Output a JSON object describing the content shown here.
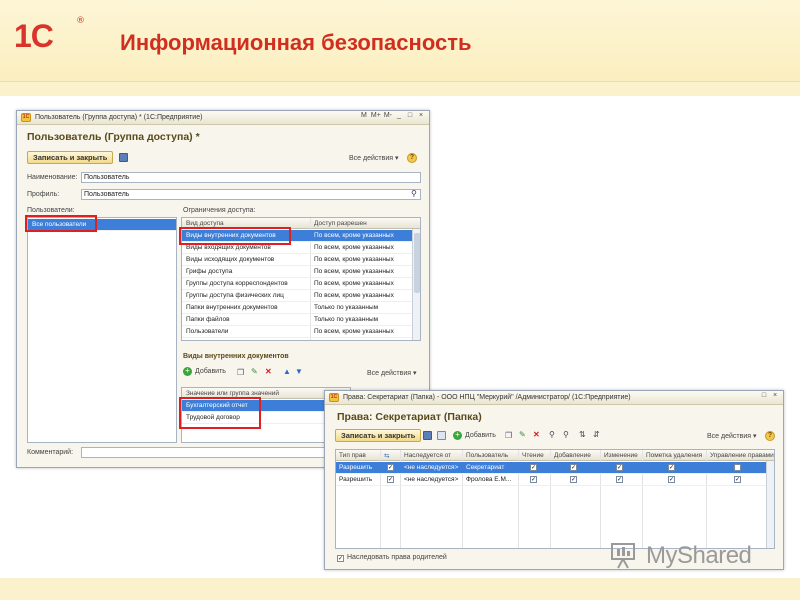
{
  "slide": {
    "logo_text": "1С",
    "logo_reg": "®",
    "title": "Информационная безопасность",
    "watermark": "MyShared"
  },
  "win1": {
    "title": "Пользователь (Группа доступа) * (1С:Предприятие)",
    "titlebar_buttons": [
      "M",
      "M+",
      "M-",
      "_",
      "□",
      "×"
    ],
    "form_title": "Пользователь (Группа доступа) *",
    "save_close_label": "Записать и закрыть",
    "all_actions_label": "Все действия ▾",
    "help_label": "?",
    "name_label": "Наименование:",
    "name_value": "Пользователь",
    "profile_label": "Профиль:",
    "profile_value": "Пользователь",
    "users_label": "Пользователи:",
    "users_items": [
      "Все пользователи"
    ],
    "restrictions_label": "Ограничения доступа:",
    "restrictions_columns": [
      "Вид доступа",
      "Доступ разрешен"
    ],
    "restrictions_rows": [
      [
        "Виды внутренних документов",
        "По всем, кроме указанных"
      ],
      [
        "Виды входящих документов",
        "По всем, кроме указанных"
      ],
      [
        "Виды исходящих документов",
        "По всем, кроме указанных"
      ],
      [
        "Грифы доступа",
        "По всем, кроме указанных"
      ],
      [
        "Группы доступа корреспондентов",
        "По всем, кроме указанных"
      ],
      [
        "Группы доступа физических лиц",
        "По всем, кроме указанных"
      ],
      [
        "Папки внутренних документов",
        "Только по указанным"
      ],
      [
        "Папки файлов",
        "Только по указанным"
      ],
      [
        "Пользователи",
        "По всем, кроме указанных"
      ]
    ],
    "doc_types_label": "Виды внутренних документов",
    "add_label": "Добавить",
    "all_actions2_label": "Все действия ▾",
    "values_column": "Значение или группа значений",
    "values_rows": [
      "Бухгалтерский отчет",
      "Трудовой договор"
    ],
    "comment_label": "Комментарий:"
  },
  "win2": {
    "title": "Права: Секретариат (Папка) - ООО НПЦ \"Меркурий\" /Администратор/ (1С:Предприятие)",
    "titlebar_buttons": [
      "□",
      "×"
    ],
    "form_title": "Права: Секретариат (Папка)",
    "save_close_label": "Записать и закрыть",
    "add_label": "Добавить",
    "all_actions_label": "Все действия ▾",
    "help_label": "?",
    "columns": [
      "Тип прав",
      "",
      "Наследуется от",
      "Пользователь",
      "Чтение",
      "Добавление",
      "Изменение",
      "Пометка удаления",
      "Управление правами"
    ],
    "rows": [
      {
        "type": "Разрешить",
        "inherit": "<не наследуется>",
        "user": "Секретариат",
        "flags": [
          true,
          true,
          true,
          true,
          true,
          false
        ]
      },
      {
        "type": "Разрешить",
        "inherit": "<не наследуется>",
        "user": "Фролова Е.М...",
        "flags": [
          true,
          true,
          true,
          true,
          true,
          true
        ]
      }
    ],
    "inherit_parent_label": "Наследовать права родителей",
    "inherit_parent_checked": true
  },
  "colors": {
    "accent_red": "#d02e1f",
    "selection_blue": "#3d7fd8",
    "highlight_box": "#e02020",
    "header_band": "#fbeec0"
  }
}
